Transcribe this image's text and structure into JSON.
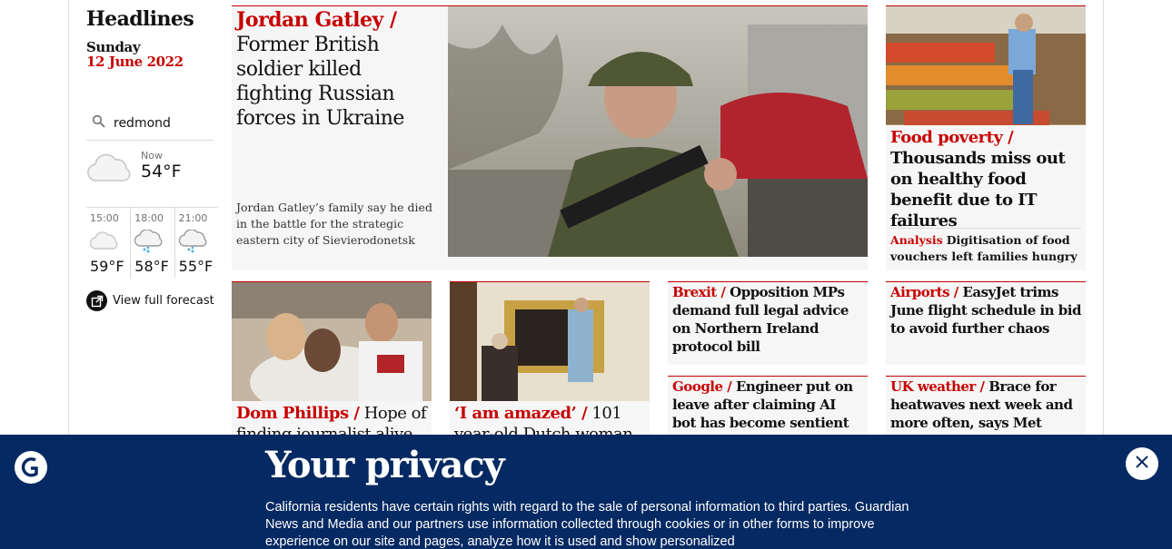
{
  "rail": {
    "title": "Headlines",
    "day": "Sunday",
    "date": "12 June 2022",
    "search_value": "redmond",
    "weather_now": {
      "label": "Now",
      "temp": "54°F"
    },
    "forecast": [
      {
        "time": "15:00",
        "temp": "59°F",
        "icon": "cloud-icon"
      },
      {
        "time": "18:00",
        "temp": "58°F",
        "icon": "rain-cloud-icon"
      },
      {
        "time": "21:00",
        "temp": "55°F",
        "icon": "rain-cloud-icon"
      }
    ],
    "view_forecast": "View full forecast"
  },
  "lead": {
    "kicker": "Jordan Gatley /",
    "headline": "Former British soldier killed fighting Russian forces in Ukraine",
    "standfirst": "Jordan Gatley’s family say he died in the battle for the strategic eastern city of Sievierodonetsk"
  },
  "food": {
    "kicker": "Food poverty /",
    "headline": "Thousands miss out on healthy food benefit due to IT failures",
    "sub_kicker": "Analysis",
    "sub_text": "Digitisation of food vouchers left families hungry"
  },
  "dom": {
    "kicker": "Dom Phillips /",
    "headline": "Hope of finding journalist alive"
  },
  "amazed": {
    "kicker": "‘I am amazed’ /",
    "headline": "101 year-old Dutch woman"
  },
  "brexit": {
    "kicker": "Brexit /",
    "headline": "Opposition MPs demand full legal advice on Northern Ireland protocol bill"
  },
  "google": {
    "kicker": "Google /",
    "headline": "Engineer put on leave after claiming AI bot has become sentient"
  },
  "airports": {
    "kicker": "Airports /",
    "headline": "EasyJet trims June flight schedule in bid to avoid further chaos"
  },
  "ukweather": {
    "kicker": "UK weather /",
    "headline": "Brace for heatwaves next week and more often, says Met Office"
  },
  "privacy": {
    "title": "Your privacy",
    "body": "California residents have certain rights with regard to the sale of personal information to third parties. Guardian News and Media and our partners use information collected through cookies or in other forms to improve experience on our site and pages, analyze how it is used and show personalized"
  },
  "colors": {
    "accent": "#c70000",
    "banner": "#052962",
    "card": "#f6f6f6"
  }
}
